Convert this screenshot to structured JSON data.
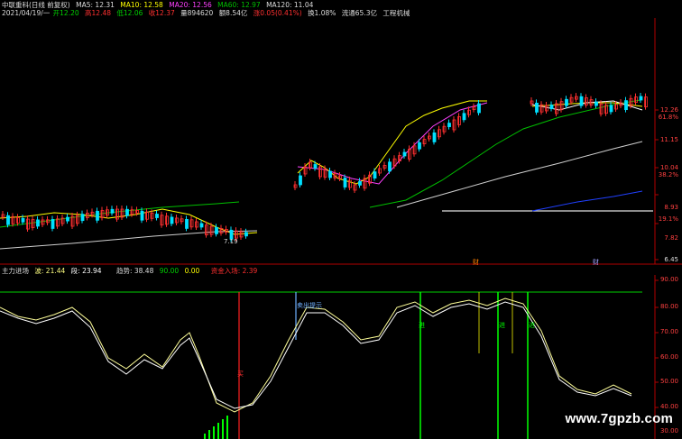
{
  "header_row1": {
    "title": "中联重科(日线 前复权)",
    "ma5": "MA5: 12.31",
    "ma10": "MA10: 12.58",
    "ma20": "MA20: 12.56",
    "ma60": "MA60: 12.97",
    "ma120": "MA120: 11.04"
  },
  "header_row2": {
    "date": "2021/04/19/一",
    "open": "开12.20",
    "high": "高12.48",
    "low": "低12.06",
    "close": "收12.37",
    "volume": "量894620",
    "amount": "额8.54亿",
    "change": "涨0.05(0.41%)",
    "turnover": "换1.08%",
    "float_cap": "流通65.3亿",
    "industry": "工程机械"
  },
  "price_axis": {
    "labels": [
      "12.26",
      "61.8%",
      "11.15",
      "10.04",
      "38.2%",
      "8.93",
      "19.1%",
      "7.82",
      "6.45"
    ],
    "label_low": "7.19"
  },
  "indicator_header": {
    "name": "主力进场",
    "v1": "波: 21.44",
    "v2": "段: 23.94",
    "trend_label": "趋势: 38.48",
    "l90": "90.00",
    "l0": "0.00",
    "signal": "资金入场: 2.39"
  },
  "indicator_axis": {
    "labels": [
      "90.00",
      "80.00",
      "70.00",
      "60.00",
      "50.00",
      "40.00",
      "30.00"
    ]
  },
  "annotations": {
    "sell_tag": "卖出提示",
    "buy_tag": "买",
    "enter_tag": "进",
    "event_a": "财",
    "event_b": "财"
  },
  "watermark": "www.7gpzb.com",
  "colors": {
    "up": "#ff3030",
    "down": "#00e0ff",
    "ma5": "#ffffff",
    "ma10": "#ffff00",
    "ma20": "#ff40ff",
    "ma60": "#00c000",
    "ma120": "#a0a0a0",
    "accent": "#ff3030"
  }
}
